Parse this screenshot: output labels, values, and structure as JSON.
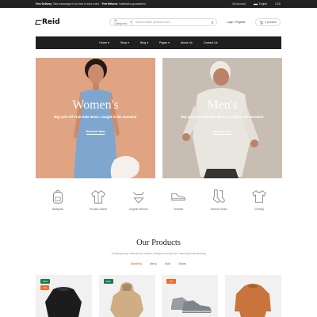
{
  "topbar": {
    "free_delivery_label": "Free Delivery",
    "free_delivery_text": ": Take advantage of our time to save event",
    "free_returns_label": "Free Returns",
    "free_returns_text": ": Satisfaction guaranteed",
    "my_account": "My Account",
    "language": "English",
    "currency": "USD"
  },
  "header": {
    "logo": "Reid",
    "search_category": "All Categories",
    "search_placeholder": "Search million products here...",
    "login": "Login",
    "separator": "/",
    "register": "Register",
    "cart_label": "0 product"
  },
  "nav": {
    "items": [
      "Home",
      "Shop",
      "Blog",
      "Pages",
      "About Us",
      "Contact Us"
    ]
  },
  "banners": {
    "women": {
      "title": "Women's",
      "subtitle": "Big Sale Off Fruit Sale Items. Caught in the moment!",
      "button": "Discover Now"
    },
    "men": {
      "title": "Men's",
      "subtitle": "Big Sale Off Fruit Sale Items. Caught in the moment!",
      "button": "Discover Now"
    }
  },
  "categories": [
    {
      "label": "Backpack",
      "icon": "backpack-icon"
    },
    {
      "label": "Hooded Jacket",
      "icon": "jacket-icon"
    },
    {
      "label": "Lingerie Women",
      "icon": "lingerie-icon"
    },
    {
      "label": "Sneaker",
      "icon": "sneaker-icon"
    },
    {
      "label": "Woman Socks",
      "icon": "socks-icon"
    },
    {
      "label": "Clothing",
      "icon": "shirt-icon"
    }
  ],
  "products": {
    "title": "Our Products",
    "subtitle": "Contemporary, minimal and modern designs embody the Lavish Alice handwriting",
    "tabs": [
      "Women's",
      "Men's",
      "Kid's",
      "Shoes"
    ],
    "active_tab": "Women's",
    "cards": [
      {
        "badges": [
          "New",
          "-7%"
        ]
      },
      {
        "badges": [
          "New"
        ]
      },
      {
        "badges": [
          "-7%"
        ]
      },
      {
        "badges": []
      }
    ]
  },
  "colors": {
    "accent": "#e0482c",
    "dark": "#1f1f1f",
    "new_badge": "#1a7a4e",
    "sale_badge": "#f06a2a"
  }
}
